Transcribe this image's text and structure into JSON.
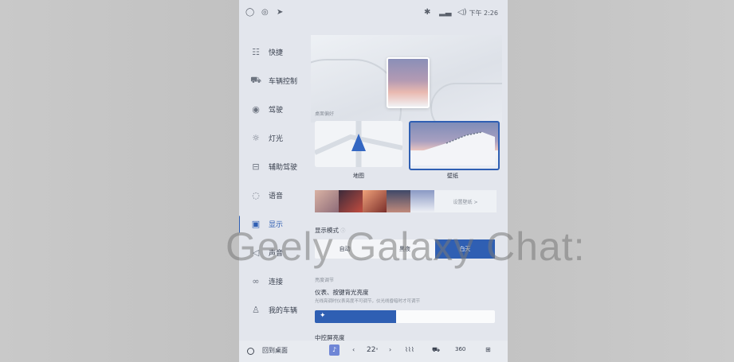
{
  "status_bar": {
    "left_icons": [
      "profile-icon",
      "signal-circle-icon",
      "navigation-arrow-icon"
    ],
    "right_icons": [
      "bluetooth-icon",
      "cellular-icon",
      "volume-icon"
    ],
    "time": "下午 2:26"
  },
  "sidebar": {
    "items": [
      {
        "label": "快捷",
        "icon": "sliders-icon",
        "glyph": "☷"
      },
      {
        "label": "车辆控制",
        "icon": "car-icon",
        "glyph": "⛟"
      },
      {
        "label": "驾驶",
        "icon": "steering-wheel-icon",
        "glyph": "◉"
      },
      {
        "label": "灯光",
        "icon": "light-icon",
        "glyph": "☼"
      },
      {
        "label": "辅助驾驶",
        "icon": "assist-drive-icon",
        "glyph": "⊟"
      },
      {
        "label": "语音",
        "icon": "voice-icon",
        "glyph": "◌"
      },
      {
        "label": "显示",
        "icon": "display-icon",
        "glyph": "▣"
      },
      {
        "label": "声音",
        "icon": "sound-icon",
        "glyph": "◁"
      },
      {
        "label": "连接",
        "icon": "link-icon",
        "glyph": "∞"
      },
      {
        "label": "我的车辆",
        "icon": "user-icon",
        "glyph": "♙"
      }
    ],
    "active_index": 6
  },
  "display": {
    "desktop_caption": "桌面偏好",
    "cards": [
      {
        "label": "地图"
      },
      {
        "label": "壁纸"
      }
    ],
    "set_wallpaper": "设置壁纸 >",
    "mode_title": "显示模式",
    "modes": [
      "自动",
      "黑夜",
      "白天"
    ],
    "active_mode": "白天",
    "brightness_caption": "亮度调节",
    "instrument_title": "仪表、按键背光亮度",
    "instrument_sub": "光线亮调时仪表亮度不可调节，仪光线昏暗时才可调节",
    "brightness_level": 0.45,
    "center_title": "中控屏亮度"
  },
  "dock": {
    "home_label": "回到桌面",
    "temperature": "22",
    "temp_unit": "°",
    "view_360": "360"
  },
  "watermark": "Geely Galaxy Chat:",
  "colors": {
    "accent": "#2f5fb3",
    "panel": "#e3e6ed"
  }
}
